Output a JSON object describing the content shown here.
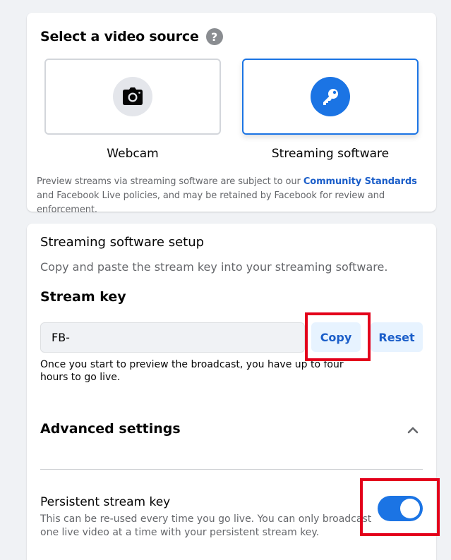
{
  "video_source": {
    "title": "Select a video source",
    "help_icon": "question-mark-icon",
    "options": [
      {
        "label": "Webcam",
        "icon": "camera-icon",
        "selected": false
      },
      {
        "label": "Streaming software",
        "icon": "key-icon",
        "selected": true
      }
    ],
    "policy_text_before": "Preview streams via streaming software are subject to our ",
    "policy_link": "Community Standards",
    "policy_text_after": " and Facebook Live policies, and may be retained by Facebook for review and enforcement."
  },
  "setup": {
    "title": "Streaming software setup",
    "description": "Copy and paste the stream key into your streaming software.",
    "stream_key_label": "Stream key",
    "stream_key_value": "FB-",
    "copy_label": "Copy",
    "reset_label": "Reset",
    "preview_note": "Once you start to preview the broadcast, you have up to four hours to go live."
  },
  "advanced": {
    "title": "Advanced settings",
    "expanded": true,
    "persistent_key_title": "Persistent stream key",
    "persistent_key_desc": "This can be re-used every time you go live. You can only broadcast one live video at a time with your persistent stream key.",
    "persistent_key_enabled": true
  },
  "colors": {
    "accent": "#1b74e4",
    "link": "#1b5ec9",
    "highlight": "#e3001b"
  }
}
